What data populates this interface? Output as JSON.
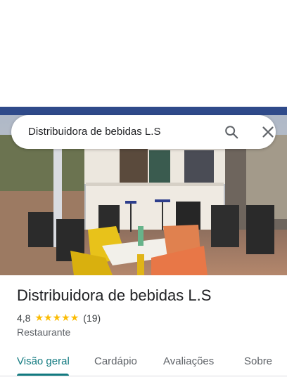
{
  "search": {
    "query": "Distribuidora de bebidas L.S",
    "icon": "search-icon",
    "clear_icon": "close-icon"
  },
  "place": {
    "name": "Distribuidora de bebidas L.S",
    "rating": "4,8",
    "rating_value": 4.8,
    "stars": [
      "★",
      "★",
      "★",
      "★",
      "★"
    ],
    "reviews_count": "(19)",
    "category": "Restaurante"
  },
  "tabs": [
    {
      "label": "Visão geral",
      "active": true
    },
    {
      "label": "Cardápio",
      "active": false
    },
    {
      "label": "Avaliações",
      "active": false
    },
    {
      "label": "Sobre",
      "active": false
    }
  ],
  "colors": {
    "accent": "#127a80",
    "star": "#fbbc04",
    "text_primary": "#202124",
    "text_secondary": "#5f6368"
  }
}
